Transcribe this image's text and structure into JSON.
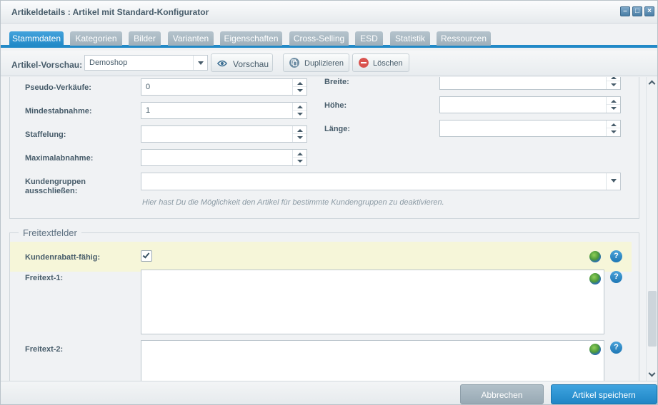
{
  "window": {
    "title": "Artikeldetails : Artikel mit Standard-Konfigurator"
  },
  "tabs": [
    {
      "label": "Stammdaten",
      "active": true
    },
    {
      "label": "Kategorien"
    },
    {
      "label": "Bilder"
    },
    {
      "label": "Varianten"
    },
    {
      "label": "Eigenschaften"
    },
    {
      "label": "Cross-Selling"
    },
    {
      "label": "ESD"
    },
    {
      "label": "Statistik"
    },
    {
      "label": "Ressourcen"
    }
  ],
  "toolbar": {
    "preview_label": "Artikel-Vorschau:",
    "shop_value": "Demoshop",
    "preview_button": "Vorschau",
    "duplicate_button": "Duplizieren",
    "delete_button": "Löschen"
  },
  "stock": {
    "pseudo_sales_label": "Pseudo-Verkäufe:",
    "pseudo_sales_value": "0",
    "min_purchase_label": "Mindestabnahme:",
    "min_purchase_value": "1",
    "graduation_label": "Staffelung:",
    "graduation_value": "",
    "max_purchase_label": "Maximalabnahme:",
    "max_purchase_value": "",
    "width_label": "Breite:",
    "height_label": "Höhe:",
    "length_label": "Länge:",
    "customer_groups_label_1": "Kundengruppen",
    "customer_groups_label_2": "ausschließen:",
    "customer_groups_hint": "Hier hast Du die Möglichkeit den Artikel für bestimmte Kundengruppen zu deaktivieren."
  },
  "freetext": {
    "legend": "Freitextfelder",
    "discount_label": "Kundenrabatt-fähig:",
    "discount_checked": true,
    "freetext1_label": "Freitext-1:",
    "freetext2_label": "Freitext-2:",
    "help_glyph": "?"
  },
  "icons": {
    "preview": "eye-icon",
    "duplicate": "copy-icon",
    "delete": "minus-circle-icon",
    "translate": "globe-icon",
    "help": "help-icon"
  },
  "footer": {
    "cancel_button": "Abbrechen",
    "save_button": "Artikel speichern"
  },
  "colors": {
    "accent": "#2189c7",
    "tab_inactive": "#a9b9c3",
    "highlight_row": "#f6f6d9",
    "delete_red": "#d9534f"
  }
}
